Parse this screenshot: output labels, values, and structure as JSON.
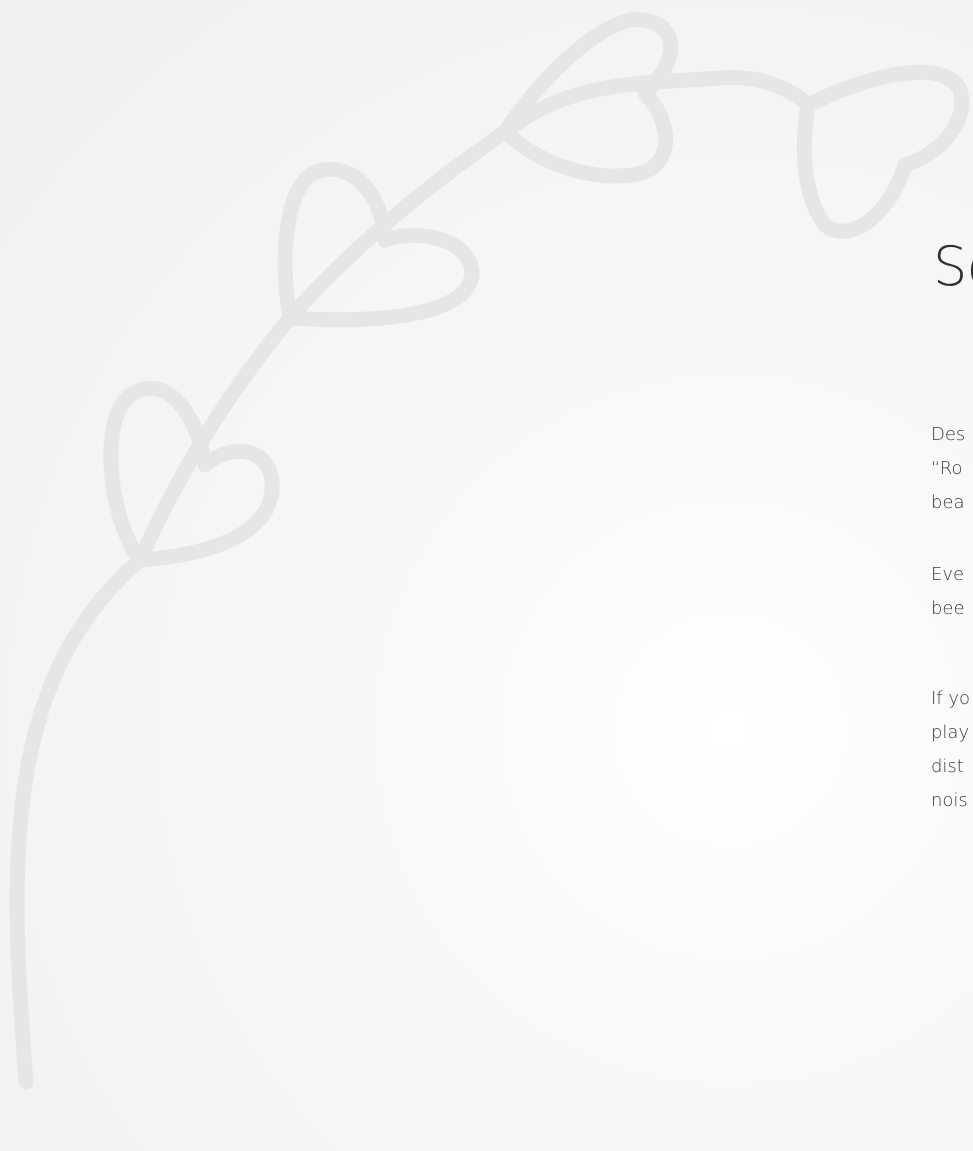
{
  "title": "Sc",
  "paragraphs": [
    {
      "lines": [
        "Des",
        "“Ro",
        "bea"
      ]
    },
    {
      "lines": [
        "Eve",
        "bee"
      ]
    },
    {
      "lines": [
        "If yo",
        "play",
        "dist",
        "nois"
      ]
    }
  ]
}
